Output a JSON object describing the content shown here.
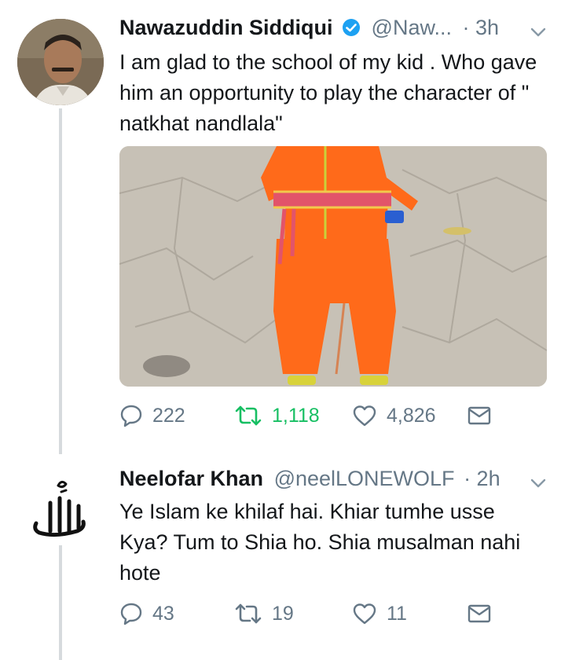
{
  "tweets": [
    {
      "name": "Nawazuddin Siddiqui",
      "verified": true,
      "handle": "@Naw...",
      "time": "· 3h",
      "text": "I am glad to the school of my kid . Who gave him an opportunity to play the character of \" natkhat nandlala\"",
      "replies": "222",
      "retweets": "1,118",
      "likes": "4,826",
      "retweeted": true
    },
    {
      "name": "Neelofar Khan",
      "verified": false,
      "handle": "@neelLONEWOLF",
      "time": "· 2h",
      "text": "Ye Islam ke khilaf hai. Khiar tumhe usse Kya? Tum to Shia ho. Shia musalman nahi hote",
      "replies": "43",
      "retweets": "19",
      "likes": "11",
      "retweeted": false
    }
  ],
  "colors": {
    "verified": "#1da1f2",
    "muted": "#657786",
    "retweet_active": "#17bf63",
    "thread_line": "#d6dadd",
    "kid_outfit": "#ff6a1a"
  },
  "icons": [
    "verified-badge-icon",
    "chevron-down-icon",
    "reply-icon",
    "retweet-icon",
    "like-icon",
    "direct-message-icon",
    "allah-calligraphy-avatar"
  ]
}
